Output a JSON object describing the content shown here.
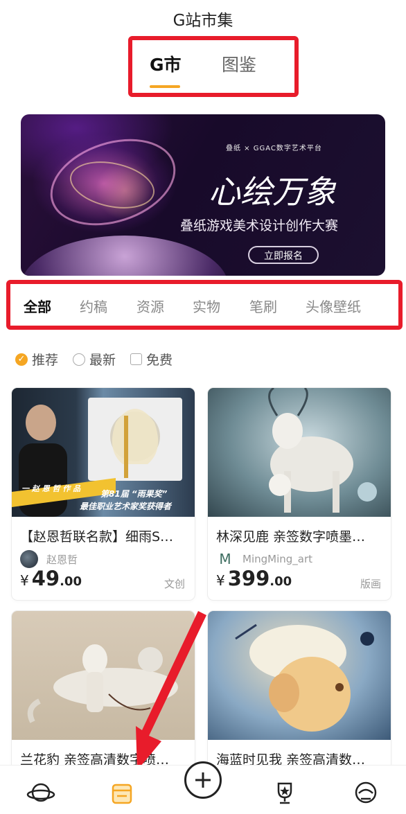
{
  "header": {
    "title": "G站市集",
    "tabs": [
      {
        "label": "G市",
        "active": true
      },
      {
        "label": "图鉴",
        "active": false
      }
    ],
    "accent_color": "#f5a623"
  },
  "banner": {
    "logo_text": "叠纸 × GGAC数字艺术平台",
    "headline": "心绘万象",
    "subtitle": "叠纸游戏美术设计创作大赛",
    "button_label": "立即报名"
  },
  "categories": [
    {
      "label": "全部",
      "active": true
    },
    {
      "label": "约稿",
      "active": false
    },
    {
      "label": "资源",
      "active": false
    },
    {
      "label": "实物",
      "active": false
    },
    {
      "label": "笔刷",
      "active": false
    },
    {
      "label": "头像壁纸",
      "active": false
    }
  ],
  "filters": [
    {
      "label": "推荐",
      "checked": true
    },
    {
      "label": "最新",
      "checked": false
    },
    {
      "label": "免费",
      "checked": false
    }
  ],
  "cards": [
    {
      "title": "【赵恩哲联名款】细雨S…",
      "author": "赵恩哲",
      "price_int": "49",
      "price_dec": ".00",
      "currency": "¥",
      "tag": "文创",
      "image_caption_1": "一 赵 恩 哲 作 品",
      "image_caption_2": "第81届 “雨果奖”",
      "image_caption_3": "最佳职业艺术家奖获得者"
    },
    {
      "title": "林深见鹿 亲签数字喷墨…",
      "author": "MingMing_art",
      "price_int": "399",
      "price_dec": ".00",
      "currency": "¥",
      "tag": "版画"
    },
    {
      "title": "兰花豹 亲签高清数字喷…",
      "author": "",
      "price_int": "",
      "price_dec": "",
      "currency": "",
      "tag": ""
    },
    {
      "title": "海蓝时见我 亲签高清数…",
      "author": "",
      "price_int": "",
      "price_dec": "",
      "currency": "",
      "tag": ""
    }
  ],
  "bottom_nav": [
    {
      "icon": "planet-icon"
    },
    {
      "icon": "shop-icon",
      "active": true
    },
    {
      "icon": "add-icon"
    },
    {
      "icon": "trophy-icon"
    },
    {
      "icon": "astronaut-icon"
    }
  ],
  "annotation_color": "#e81c2b"
}
